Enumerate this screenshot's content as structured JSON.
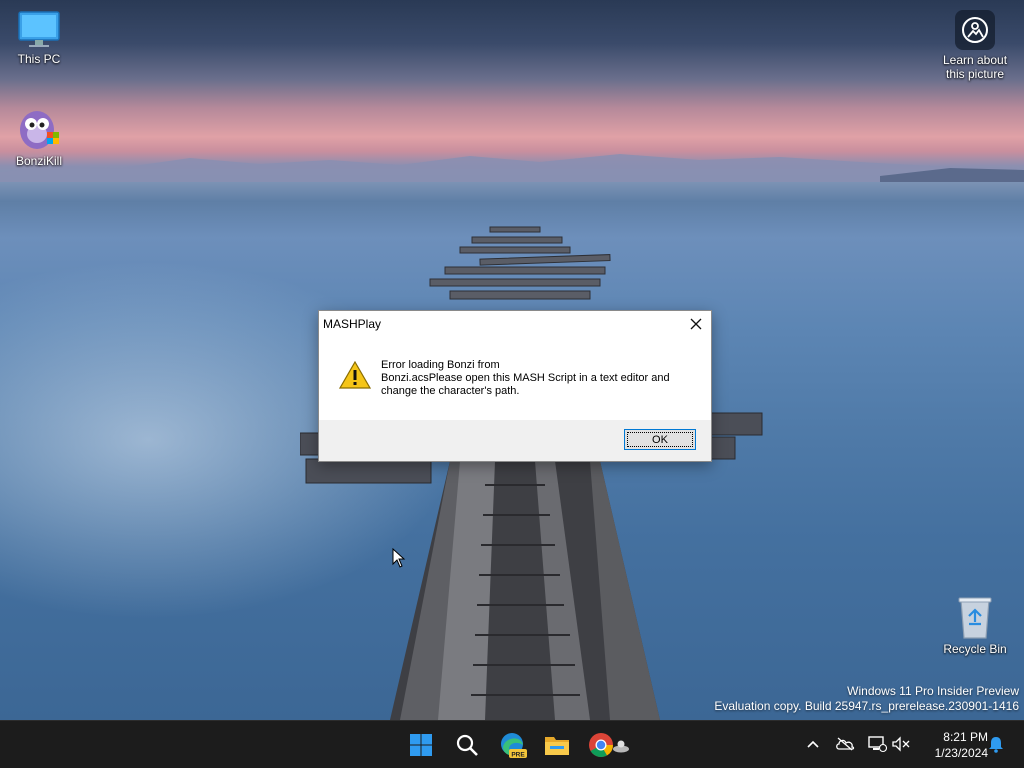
{
  "desktop": {
    "icons": [
      {
        "label": "This PC"
      },
      {
        "label": "BonziKill"
      },
      {
        "label": "Learn about this picture"
      },
      {
        "label": "Recycle Bin"
      }
    ],
    "watermark": {
      "line1": "Windows 11 Pro Insider Preview",
      "line2": "Evaluation copy. Build 25947.rs_prerelease.230901-1416"
    }
  },
  "dialog": {
    "title": "MASHPlay",
    "message_line1": "Error loading Bonzi from",
    "message_line2": "Bonzi.acsPlease open this MASH Script in a text editor and",
    "message_line3": "change the character's path.",
    "ok_label": "OK",
    "icon": "warning-icon"
  },
  "taskbar": {
    "apps": [
      "start-icon",
      "search-icon",
      "edge-icon",
      "file-explorer-icon",
      "chrome-icon"
    ],
    "edge_badge": "PRE",
    "tray": [
      "chevron-up-icon",
      "onedrive-icon",
      "network-icon",
      "volume-muted-icon"
    ],
    "time": "8:21 PM",
    "date": "1/23/2024"
  },
  "colors": {
    "accent": "#0078d4",
    "taskbar_bg": "#1c1c1c",
    "warning_yellow": "#f5c518"
  }
}
